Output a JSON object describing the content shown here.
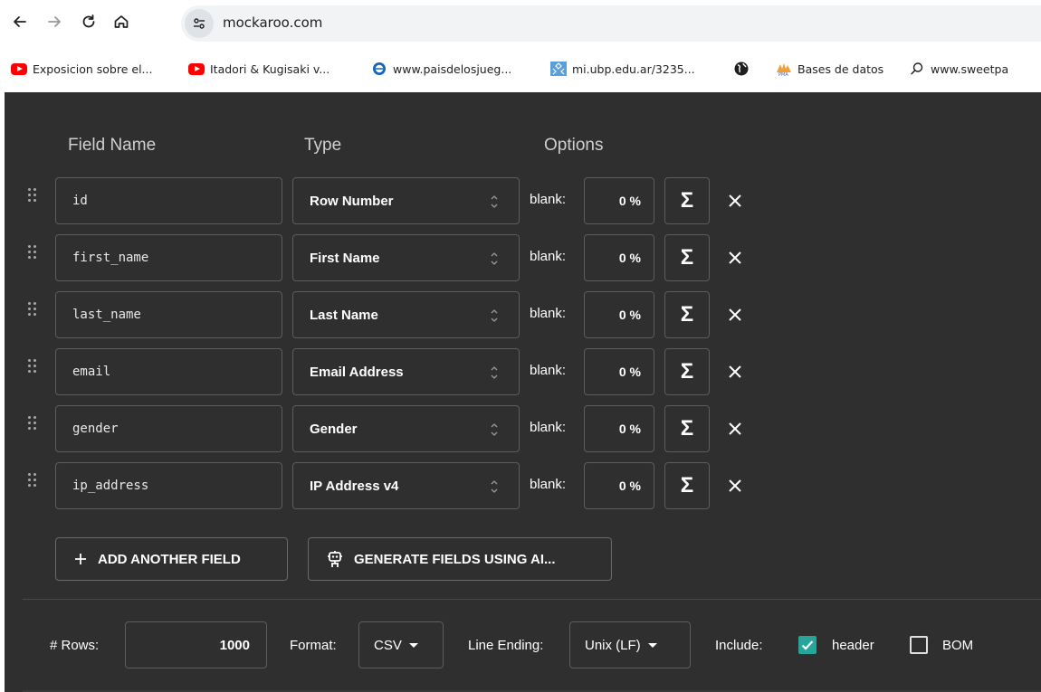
{
  "browser": {
    "url": "mockaroo.com",
    "bookmarks": [
      {
        "label": "Exposicion sobre el...",
        "icon": "youtube-icon"
      },
      {
        "label": "Itadori & Kugisaki v...",
        "icon": "youtube-icon"
      },
      {
        "label": "www.paisdelosjueg...",
        "icon": "globe-ring-icon"
      },
      {
        "label": "mi.ubp.edu.ar/3235...",
        "icon": "ubp-icon"
      },
      {
        "label": "",
        "icon": "globe-icon"
      },
      {
        "label": "Bases de datos",
        "icon": "pma-icon"
      },
      {
        "label": "www.sweetpa",
        "icon": "search-icon"
      }
    ]
  },
  "headers": {
    "field_name": "Field Name",
    "type": "Type",
    "options": "Options"
  },
  "fields": [
    {
      "name": "id",
      "type": "Row Number",
      "blank_label": "blank:",
      "blank": "0 %"
    },
    {
      "name": "first_name",
      "type": "First Name",
      "blank_label": "blank:",
      "blank": "0 %"
    },
    {
      "name": "last_name",
      "type": "Last Name",
      "blank_label": "blank:",
      "blank": "0 %"
    },
    {
      "name": "email",
      "type": "Email Address",
      "blank_label": "blank:",
      "blank": "0 %"
    },
    {
      "name": "gender",
      "type": "Gender",
      "blank_label": "blank:",
      "blank": "0 %"
    },
    {
      "name": "ip_address",
      "type": "IP Address v4",
      "blank_label": "blank:",
      "blank": "0 %"
    }
  ],
  "sigma_symbol": "Σ",
  "actions": {
    "add_field": "ADD ANOTHER FIELD",
    "generate_ai": "GENERATE FIELDS USING AI..."
  },
  "footer": {
    "rows_label": "# Rows:",
    "rows_value": "1000",
    "format_label": "Format:",
    "format_value": "CSV",
    "line_ending_label": "Line Ending:",
    "line_ending_value": "Unix (LF)",
    "include_label": "Include:",
    "header_label": "header",
    "header_checked": true,
    "bom_label": "BOM",
    "bom_checked": false
  },
  "colors": {
    "app_bg": "#2f2f2f",
    "checkbox_accent": "#26a69a"
  }
}
